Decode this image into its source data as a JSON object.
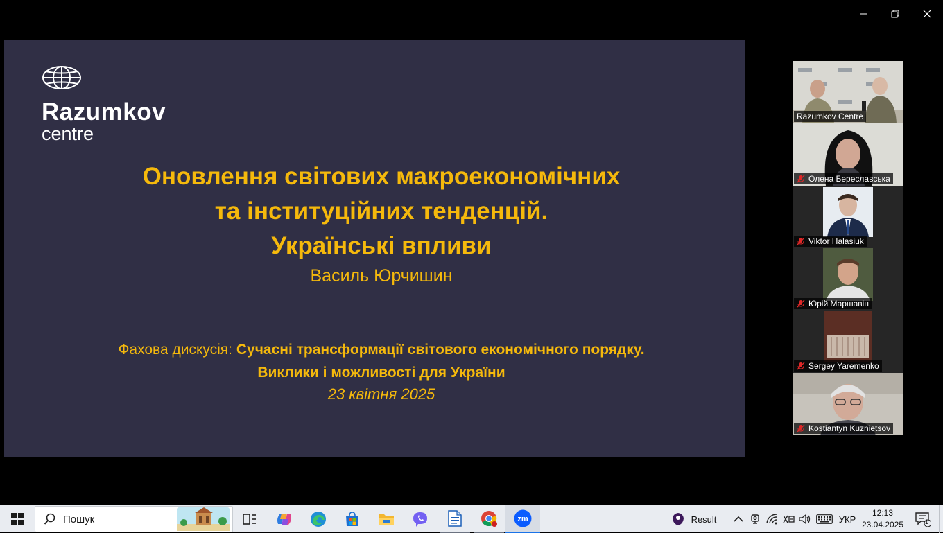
{
  "window": {
    "controls": [
      "minimize-icon",
      "restore-icon",
      "close-icon"
    ]
  },
  "slide": {
    "logo_name": "Razumkov",
    "logo_sub": "centre",
    "title_line1": "Оновлення світових макроекономічних",
    "title_line2": "та інституційних тенденцій.",
    "title_line3": "Українські впливи",
    "author": "Василь Юрчишин",
    "discussion_label": "Фахова дискусія:",
    "discussion_title1": "Сучасні трансформації світового економічного порядку.",
    "discussion_title2": "Виклики і можливості для України",
    "date": "23 квітня 2025",
    "bg_color": "#302f45",
    "accent_color": "#f5b90c"
  },
  "participants": [
    {
      "name": "Razumkov Centre",
      "muted": false,
      "active": true
    },
    {
      "name": "Олена Береславська",
      "muted": true,
      "active": false
    },
    {
      "name": "Viktor Halasiuk",
      "muted": true,
      "active": false
    },
    {
      "name": "Юрій Маршавін",
      "muted": true,
      "active": false
    },
    {
      "name": "Sergey Yaremenko",
      "muted": true,
      "active": false
    },
    {
      "name": "Kostiantyn Kuznietsov",
      "muted": true,
      "active": false
    }
  ],
  "taskbar": {
    "search_placeholder": "Пошук",
    "apps": [
      "task-view-icon",
      "copilot-icon",
      "edge-icon",
      "store-icon",
      "file-explorer-icon",
      "viber-icon",
      "libreoffice-writer-icon",
      "chrome-icon",
      "zoom-icon"
    ],
    "widget_label": "Result",
    "language": "УКР",
    "time": "12:13",
    "date": "23.04.2025",
    "notification_count": "1"
  }
}
